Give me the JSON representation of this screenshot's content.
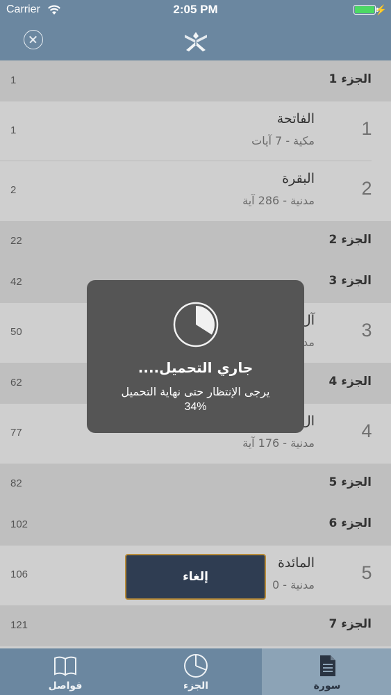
{
  "status_bar": {
    "carrier": "Carrier",
    "time": "2:05 PM",
    "battery_color": "#4cd964"
  },
  "nav_bar": {
    "close_icon": "close-circle-icon",
    "logo_icon": "quran-book-logo-icon"
  },
  "list": {
    "juz_rows": [
      {
        "title": "الجزء 1",
        "page": "1"
      },
      {
        "title": "الجزء 2",
        "page": "22"
      },
      {
        "title": "الجزء 3",
        "page": "42"
      },
      {
        "title": "الجزء 4",
        "page": "62"
      },
      {
        "title": "الجزء 5",
        "page": "82"
      },
      {
        "title": "الجزء 6",
        "page": "102"
      },
      {
        "title": "الجزء 7",
        "page": "121"
      }
    ],
    "surah_rows": [
      {
        "index": "1",
        "name": "الفاتحة",
        "meta": "مكية - 7 آيات",
        "page": "1"
      },
      {
        "index": "2",
        "name": "البقرة",
        "meta": "مدنية - 286 آية",
        "page": "2"
      },
      {
        "index": "3",
        "name": "آل",
        "meta": "مد",
        "page": "50"
      },
      {
        "index": "4",
        "name": "ال",
        "meta": "مدنية - 176 آية",
        "page": "77"
      },
      {
        "index": "5",
        "name": "المائدة",
        "meta": "مدنية - 0",
        "page": "106"
      }
    ]
  },
  "loader": {
    "title": "جاري التحميل....",
    "message": "يرجى الإنتظار حتى نهاية التحميل",
    "percent_text": "34%",
    "progress": 0.34,
    "icon": "progress-pie-icon"
  },
  "cancel_button": {
    "label": "إلغاء",
    "border_color": "#b88c3a",
    "background_color": "#2f3d52"
  },
  "tab_bar": {
    "tabs": [
      {
        "label": "فواصل",
        "icon": "open-book-icon",
        "active": false
      },
      {
        "label": "الجزء",
        "icon": "pie-chart-icon",
        "active": false
      },
      {
        "label": "سورة",
        "icon": "document-icon",
        "active": true
      }
    ],
    "accent_color": "#6b87a0"
  }
}
